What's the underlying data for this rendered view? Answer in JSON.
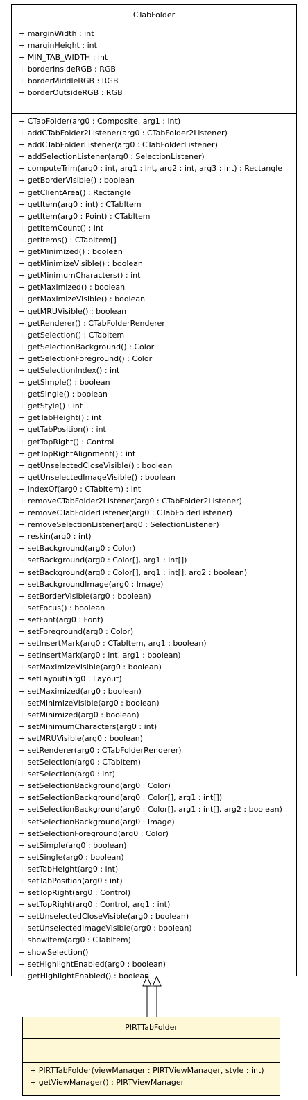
{
  "superclass": {
    "name": "CTabFolder",
    "fields": [
      "+ marginWidth : int",
      "+ marginHeight : int",
      "+ MIN_TAB_WIDTH : int",
      "+ borderInsideRGB : RGB",
      "+ borderMiddleRGB : RGB",
      "+ borderOutsideRGB : RGB"
    ],
    "methods": [
      "+ CTabFolder(arg0 : Composite, arg1 : int)",
      "+ addCTabFolder2Listener(arg0 : CTabFolder2Listener)",
      "+ addCTabFolderListener(arg0 : CTabFolderListener)",
      "+ addSelectionListener(arg0 : SelectionListener)",
      "+ computeTrim(arg0 : int, arg1 : int, arg2 : int, arg3 : int) : Rectangle",
      "+ getBorderVisible() : boolean",
      "+ getClientArea() : Rectangle",
      "+ getItem(arg0 : int) : CTabItem",
      "+ getItem(arg0 : Point) : CTabItem",
      "+ getItemCount() : int",
      "+ getItems() : CTabItem[]",
      "+ getMinimized() : boolean",
      "+ getMinimizeVisible() : boolean",
      "+ getMinimumCharacters() : int",
      "+ getMaximized() : boolean",
      "+ getMaximizeVisible() : boolean",
      "+ getMRUVisible() : boolean",
      "+ getRenderer() : CTabFolderRenderer",
      "+ getSelection() : CTabItem",
      "+ getSelectionBackground() : Color",
      "+ getSelectionForeground() : Color",
      "+ getSelectionIndex() : int",
      "+ getSimple() : boolean",
      "+ getSingle() : boolean",
      "+ getStyle() : int",
      "+ getTabHeight() : int",
      "+ getTabPosition() : int",
      "+ getTopRight() : Control",
      "+ getTopRightAlignment() : int",
      "+ getUnselectedCloseVisible() : boolean",
      "+ getUnselectedImageVisible() : boolean",
      "+ indexOf(arg0 : CTabItem) : int",
      "+ removeCTabFolder2Listener(arg0 : CTabFolder2Listener)",
      "+ removeCTabFolderListener(arg0 : CTabFolderListener)",
      "+ removeSelectionListener(arg0 : SelectionListener)",
      "+ reskin(arg0 : int)",
      "+ setBackground(arg0 : Color)",
      "+ setBackground(arg0 : Color[], arg1 : int[])",
      "+ setBackground(arg0 : Color[], arg1 : int[], arg2 : boolean)",
      "+ setBackgroundImage(arg0 : Image)",
      "+ setBorderVisible(arg0 : boolean)",
      "+ setFocus() : boolean",
      "+ setFont(arg0 : Font)",
      "+ setForeground(arg0 : Color)",
      "+ setInsertMark(arg0 : CTabItem, arg1 : boolean)",
      "+ setInsertMark(arg0 : int, arg1 : boolean)",
      "+ setMaximizeVisible(arg0 : boolean)",
      "+ setLayout(arg0 : Layout)",
      "+ setMaximized(arg0 : boolean)",
      "+ setMinimizeVisible(arg0 : boolean)",
      "+ setMinimized(arg0 : boolean)",
      "+ setMinimumCharacters(arg0 : int)",
      "+ setMRUVisible(arg0 : boolean)",
      "+ setRenderer(arg0 : CTabFolderRenderer)",
      "+ setSelection(arg0 : CTabItem)",
      "+ setSelection(arg0 : int)",
      "+ setSelectionBackground(arg0 : Color)",
      "+ setSelectionBackground(arg0 : Color[], arg1 : int[])",
      "+ setSelectionBackground(arg0 : Color[], arg1 : int[], arg2 : boolean)",
      "+ setSelectionBackground(arg0 : Image)",
      "+ setSelectionForeground(arg0 : Color)",
      "+ setSimple(arg0 : boolean)",
      "+ setSingle(arg0 : boolean)",
      "+ setTabHeight(arg0 : int)",
      "+ setTabPosition(arg0 : int)",
      "+ setTopRight(arg0 : Control)",
      "+ setTopRight(arg0 : Control, arg1 : int)",
      "+ setUnselectedCloseVisible(arg0 : boolean)",
      "+ setUnselectedImageVisible(arg0 : boolean)",
      "+ showItem(arg0 : CTabItem)",
      "+ showSelection()",
      "+ setHighlightEnabled(arg0 : boolean)",
      "+ getHighlightEnabled() : boolean"
    ]
  },
  "subclass": {
    "name": "PIRTTabFolder",
    "fields": [],
    "methods": [
      "+ PIRTTabFolder(viewManager : PIRTViewManager, style : int)",
      "+ getViewManager() : PIRTViewManager"
    ]
  },
  "colors": {
    "superclass_fill": "#ffffff",
    "subclass_fill": "#fff8d6",
    "line": "#000000"
  }
}
